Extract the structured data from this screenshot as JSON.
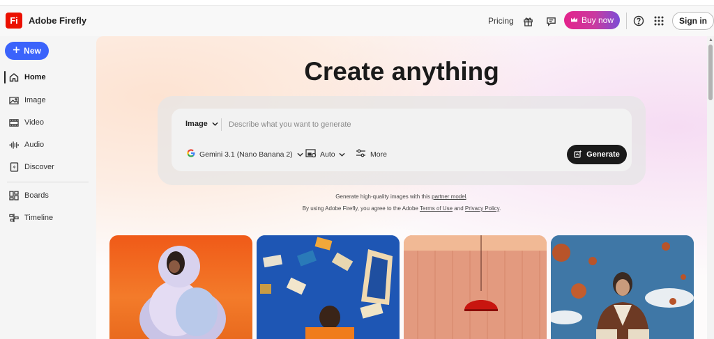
{
  "header": {
    "logo_text": "Fi",
    "app_title": "Adobe Firefly",
    "pricing_label": "Pricing",
    "buy_label": "Buy now",
    "signin_label": "Sign in"
  },
  "sidebar": {
    "new_label": "New",
    "items": [
      {
        "label": "Home",
        "icon": "home-icon",
        "active": true
      },
      {
        "label": "Image",
        "icon": "image-icon"
      },
      {
        "label": "Video",
        "icon": "video-icon"
      },
      {
        "label": "Audio",
        "icon": "audio-icon"
      },
      {
        "label": "Discover",
        "icon": "discover-icon"
      },
      {
        "label": "Boards",
        "icon": "boards-icon"
      },
      {
        "label": "Timeline",
        "icon": "timeline-icon"
      }
    ]
  },
  "main": {
    "title": "Create anything",
    "prompt": {
      "type_label": "Image",
      "placeholder": "Describe what you want to generate",
      "model_label": "Gemini 3.1 (Nano Banana 2)",
      "aspect_label": "Auto",
      "more_label": "More",
      "generate_label": "Generate"
    },
    "note1_prefix": "Generate high-quality images with this ",
    "note1_link": "partner model",
    "note1_suffix": ".",
    "note2_prefix": "By using Adobe Firefly, you agree to the Adobe ",
    "note2_terms": "Terms of Use",
    "note2_and": " and ",
    "note2_privacy": "Privacy Policy",
    "note2_suffix": "."
  },
  "colors": {
    "brand": "#eb1000",
    "new_button": "#3b63fb",
    "generate_button": "#1a1a1a",
    "buy_gradient_start": "#e4238b",
    "buy_gradient_end": "#7b4dd6"
  }
}
